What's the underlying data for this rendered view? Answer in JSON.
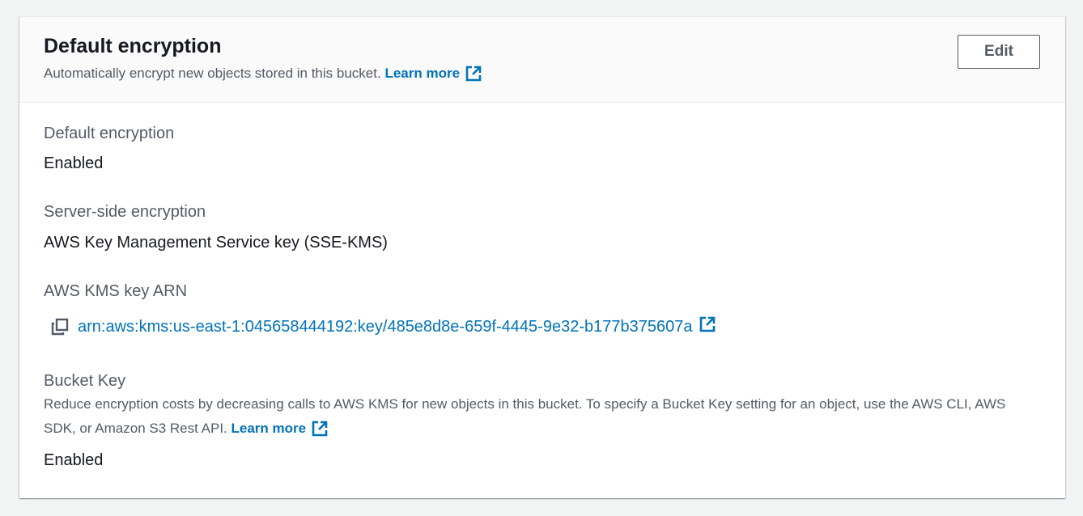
{
  "section": {
    "title": "Default encryption",
    "description": "Automatically encrypt new objects stored in this bucket.",
    "learn_more": "Learn more",
    "edit_label": "Edit"
  },
  "fields": {
    "default_encryption": {
      "label": "Default encryption",
      "value": "Enabled"
    },
    "server_side_encryption": {
      "label": "Server-side encryption",
      "value": "AWS Key Management Service key (SSE-KMS)"
    },
    "kms_key_arn": {
      "label": "AWS KMS key ARN",
      "value": "arn:aws:kms:us-east-1:045658444192:key/485e8d8e-659f-4445-9e32-b177b375607a"
    },
    "bucket_key": {
      "label": "Bucket Key",
      "description": "Reduce encryption costs by decreasing calls to AWS KMS for new objects in this bucket. To specify a Bucket Key setting for an object, use the AWS CLI, AWS SDK, or Amazon S3 Rest API.",
      "learn_more": "Learn more",
      "value": "Enabled"
    }
  },
  "icons": {
    "external_link": "external-link-icon",
    "copy": "copy-icon"
  },
  "colors": {
    "link": "#0073bb",
    "text": "#16191f",
    "secondary_text": "#545b64",
    "background": "#f2f3f3"
  }
}
